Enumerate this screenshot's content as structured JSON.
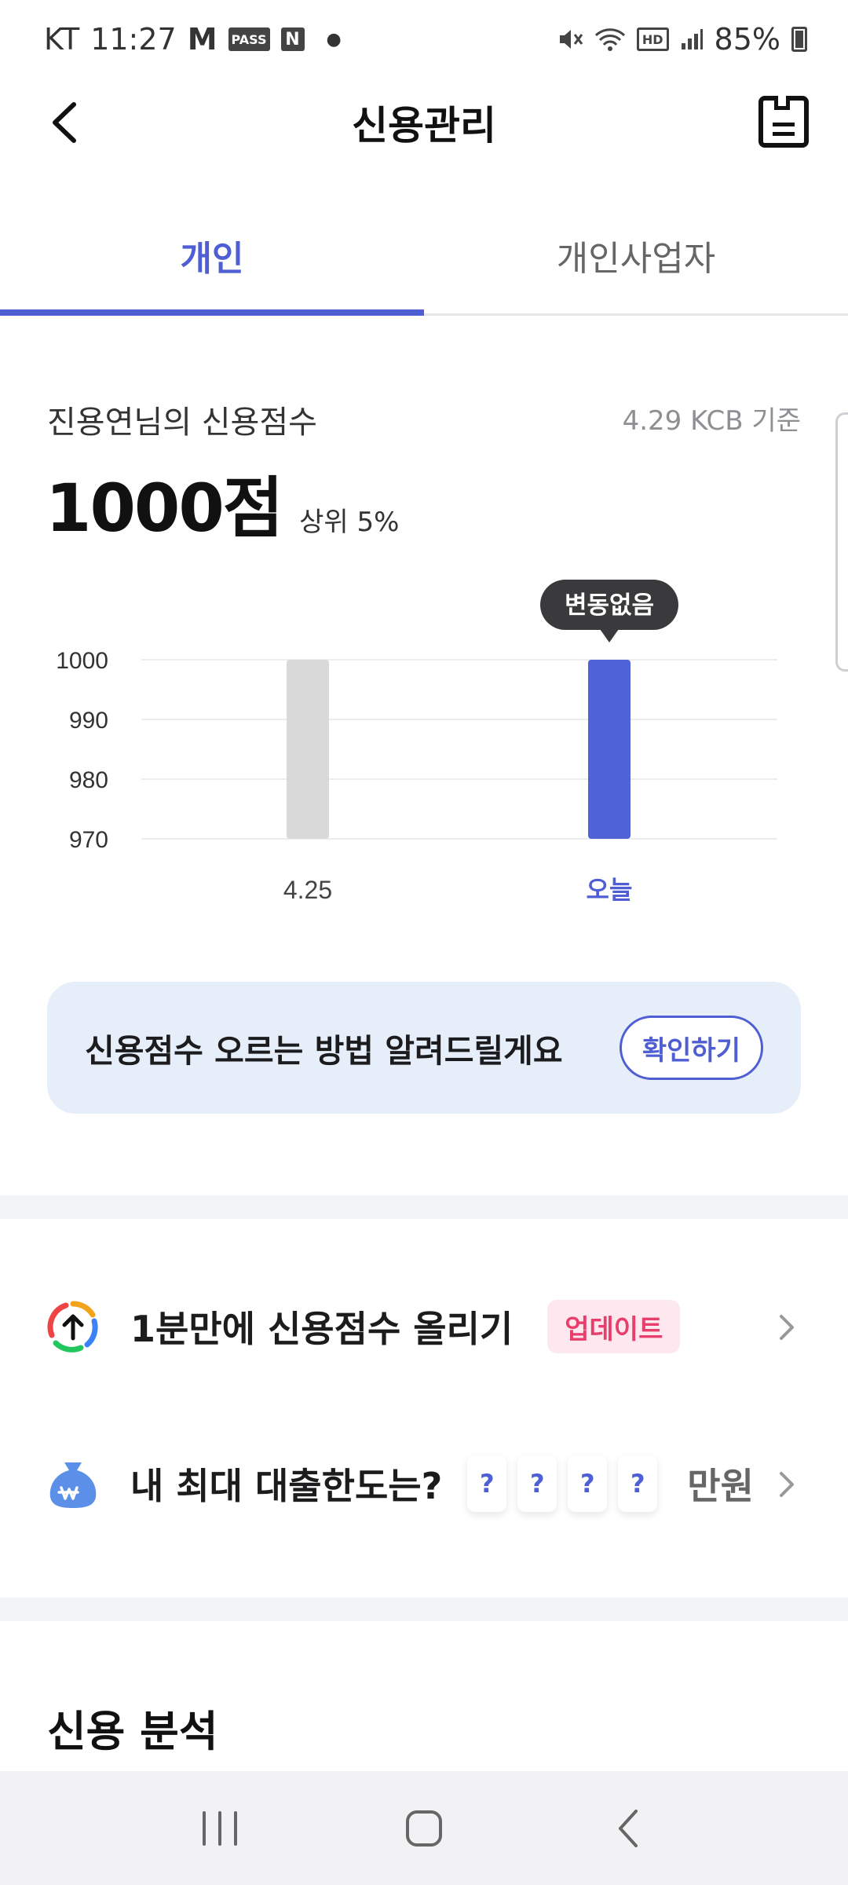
{
  "status_bar": {
    "carrier": "KT",
    "time": "11:27",
    "notif_gmail": "M",
    "notif_pass": "PASS",
    "notif_naver": "N",
    "hd_label": "HD",
    "battery": "85%"
  },
  "header": {
    "title": "신용관리"
  },
  "tabs": [
    {
      "label": "개인",
      "active": true
    },
    {
      "label": "개인사업자",
      "active": false
    }
  ],
  "score": {
    "label": "진용연님의 신용점수",
    "basis": "4.29 KCB 기준",
    "value": "1000점",
    "rank": "상위 5%"
  },
  "chart_data": {
    "type": "bar",
    "categories": [
      "4.25",
      "오늘"
    ],
    "values": [
      1000,
      1000
    ],
    "yticks": [
      1000,
      990,
      980,
      970
    ],
    "ylim": [
      970,
      1000
    ],
    "colors": [
      "#d9d9d9",
      "#4f63d6"
    ],
    "highlight_index": 1,
    "highlight_label_color": "#4f5fd3",
    "tooltip": "변동없음",
    "grid": true
  },
  "tip": {
    "text": "신용점수 오르는 방법 알려드릴게요",
    "button": "확인하기"
  },
  "rows": {
    "raise_score": {
      "title": "1분만에 신용점수 올리기",
      "badge": "업데이트",
      "icon": "arrow-up-circle-icon"
    },
    "loan_limit": {
      "title": "내 최대 대출한도는?",
      "masks": [
        "?",
        "?",
        "?",
        "?"
      ],
      "unit": "만원",
      "icon": "money-bag-icon"
    }
  },
  "section": {
    "title": "신용 분석"
  },
  "colors": {
    "accent": "#4f5fd3",
    "badge_bg": "#fde8ef",
    "badge_text": "#e83e6c",
    "banner_bg": "#e6eefa"
  }
}
